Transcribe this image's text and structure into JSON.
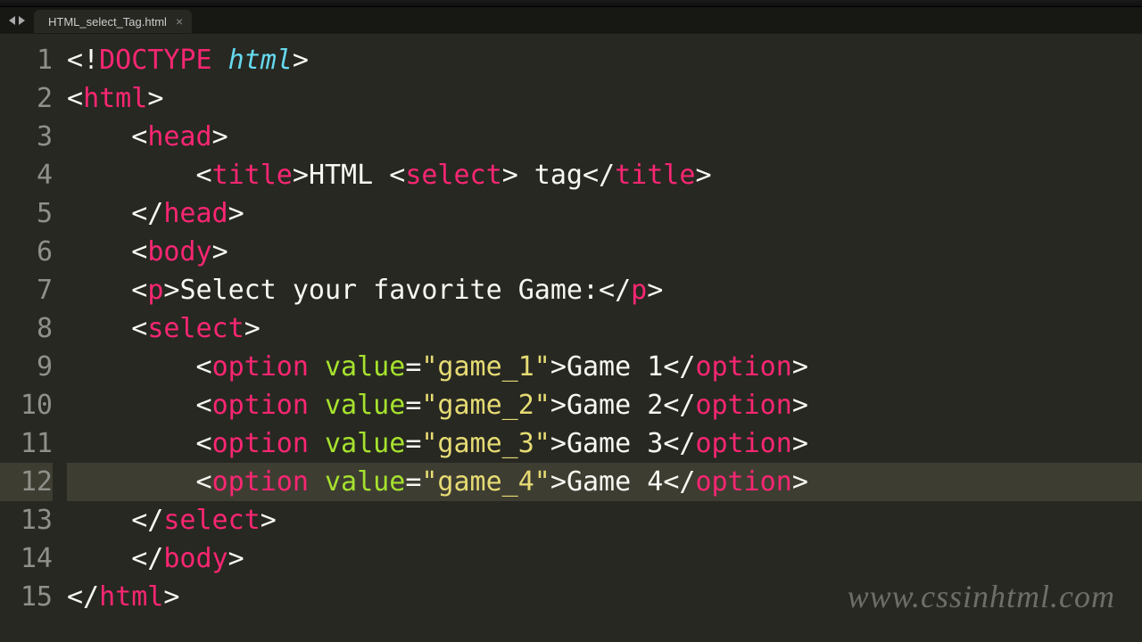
{
  "tab": {
    "filename": "HTML_select_Tag.html",
    "close_glyph": "×"
  },
  "line_numbers": [
    "1",
    "2",
    "3",
    "4",
    "5",
    "6",
    "7",
    "8",
    "9",
    "10",
    "11",
    "12",
    "13",
    "14",
    "15"
  ],
  "highlight_line": 12,
  "watermark": "www.cssinhtml.com",
  "code": {
    "l1": {
      "open": "<!",
      "doctype": "DOCTYPE",
      "sp": " ",
      "html": "html",
      "close": ">"
    },
    "l2": {
      "open": "<",
      "tag": "html",
      "close": ">"
    },
    "l3": {
      "indent": "    ",
      "open": "<",
      "tag": "head",
      "close": ">"
    },
    "l4": {
      "indent": "        ",
      "open": "<",
      "tag": "title",
      "close": ">",
      "text1": "HTML ",
      "lt": "<",
      "sel": "select",
      "gt": ">",
      "text2": " tag",
      "openc": "</",
      "close2": ">"
    },
    "l5": {
      "indent": "    ",
      "open": "</",
      "tag": "head",
      "close": ">"
    },
    "l6": {
      "indent": "    ",
      "open": "<",
      "tag": "body",
      "close": ">"
    },
    "l7": {
      "indent": "    ",
      "open": "<",
      "tag": "p",
      "close": ">",
      "text": "Select your favorite Game:",
      "openc": "</",
      "close2": ">"
    },
    "l8": {
      "indent": "    ",
      "open": "<",
      "tag": "select",
      "close": ">"
    },
    "opt": [
      {
        "indent": "        ",
        "tag": "option",
        "attr": "value",
        "val": "\"game_1\"",
        "text": "Game 1"
      },
      {
        "indent": "        ",
        "tag": "option",
        "attr": "value",
        "val": "\"game_2\"",
        "text": "Game 2"
      },
      {
        "indent": "        ",
        "tag": "option",
        "attr": "value",
        "val": "\"game_3\"",
        "text": "Game 3"
      },
      {
        "indent": "        ",
        "tag": "option",
        "attr": "value",
        "val": "\"game_4\"",
        "text": "Game 4"
      }
    ],
    "l13": {
      "indent": "    ",
      "open": "</",
      "tag": "select",
      "close": ">"
    },
    "l14": {
      "indent": "    ",
      "open": "</",
      "tag": "body",
      "close": ">"
    },
    "l15": {
      "open": "</",
      "tag": "html",
      "close": ">"
    }
  }
}
